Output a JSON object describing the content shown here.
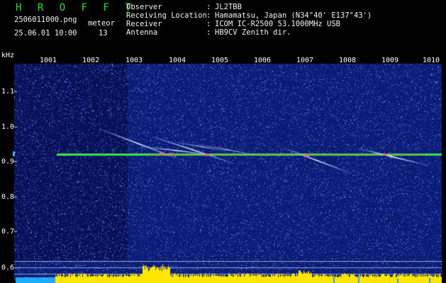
{
  "header": {
    "app_title": "H R O F F T",
    "filename": "2506011000.png",
    "meteor_label": "meteor",
    "datetime": "25.06.01 10:00",
    "meteor_count": "13"
  },
  "station": {
    "rows": [
      {
        "key": "Observer",
        "value": "JL2TBB"
      },
      {
        "key": "Receiving Location",
        "value": "Hamamatsu, Japan (N34°40' E137°43')"
      },
      {
        "key": "Receiver",
        "value": "ICOM IC-R2500 53.1000MHz USB"
      },
      {
        "key": "Antenna",
        "value": "HB9CV Zenith dir."
      }
    ]
  },
  "axes": {
    "unit": "kHz",
    "y_ticks": [
      "1.1",
      "1.0",
      "0.9",
      "0.8",
      "0.7",
      "0.6"
    ],
    "x_ticks": [
      "1001",
      "1002",
      "1003",
      "1004",
      "1005",
      "1006",
      "1007",
      "1008",
      "1009",
      "1010"
    ]
  },
  "colors": {
    "background": "#000000",
    "plot_bg": "#0b1a72",
    "carrier": "#38e84a",
    "trace": "#e8f0ff",
    "header_green": "#2fe12f",
    "level_fill": "#ffe600",
    "timebar": "#22a8ff"
  }
}
